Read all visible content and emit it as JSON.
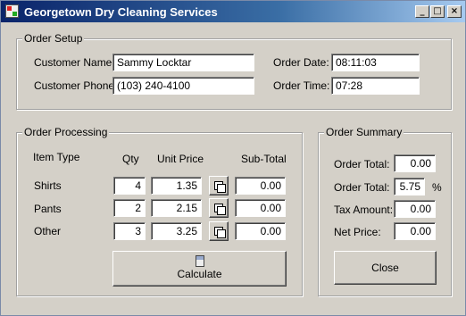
{
  "window": {
    "title": "Georgetown Dry Cleaning Services",
    "min": "_",
    "max": "□",
    "close": "×"
  },
  "order_setup": {
    "title": "Order Setup",
    "customer_name_label": "Customer Name:",
    "customer_name": "Sammy Locktar",
    "customer_phone_label": "Customer Phone:",
    "customer_phone": "(103) 240-4100",
    "order_date_label": "Order Date:",
    "order_date": "08:11:03",
    "order_time_label": "Order Time:",
    "order_time": "07:28"
  },
  "order_processing": {
    "title": "Order Processing",
    "col_item_type": "Item Type",
    "col_qty": "Qty",
    "col_unit_price": "Unit Price",
    "col_subtotal": "Sub-Total",
    "items": [
      {
        "name": "Shirts",
        "qty": "4",
        "unit_price": "1.35",
        "subtotal": "0.00"
      },
      {
        "name": "Pants",
        "qty": "2",
        "unit_price": "2.15",
        "subtotal": "0.00"
      },
      {
        "name": "Other",
        "qty": "3",
        "unit_price": "3.25",
        "subtotal": "0.00"
      }
    ],
    "calculate_label": "Calculate"
  },
  "order_summary": {
    "title": "Order Summary",
    "order_total_label": "Order Total:",
    "order_total": "0.00",
    "tax_rate_label": "Order Total:",
    "tax_rate": "5.75",
    "tax_rate_unit": "%",
    "tax_amount_label": "Tax Amount:",
    "tax_amount": "0.00",
    "net_price_label": "Net Price:",
    "net_price": "0.00",
    "close_label": "Close"
  }
}
